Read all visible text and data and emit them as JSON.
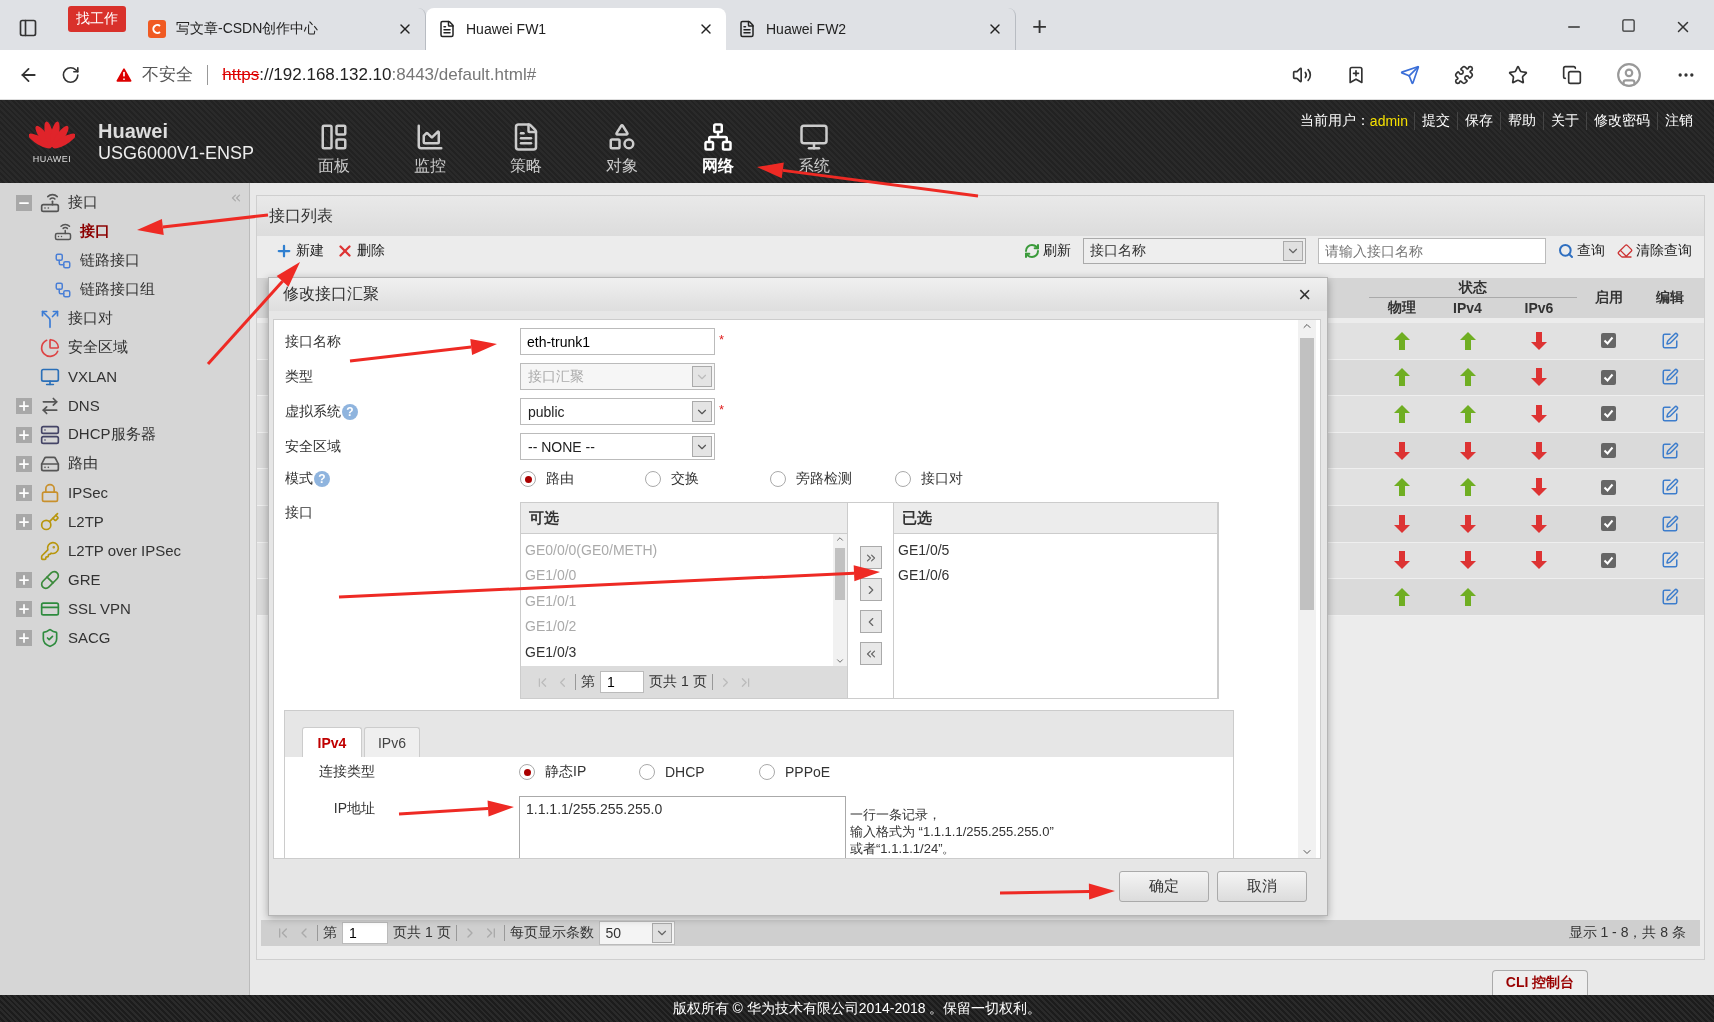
{
  "browser": {
    "badge": "找工作",
    "tabs": [
      {
        "label": "写文章-CSDN创作中心",
        "selected": false,
        "kind": "site"
      },
      {
        "label": "Huawei FW1",
        "selected": true,
        "kind": "page"
      },
      {
        "label": "Huawei FW2",
        "selected": false,
        "kind": "page"
      }
    ],
    "new_tab": "+",
    "security": "不安全",
    "url_scheme": "https",
    "url_host": "://192.168.132.10",
    "url_path": ":8443/default.html#"
  },
  "header": {
    "logo_text": "HUAWEI",
    "brand": "Huawei",
    "model": "USG6000V1-ENSP",
    "nav": [
      {
        "label": "面板",
        "selected": false
      },
      {
        "label": "监控",
        "selected": false
      },
      {
        "label": "策略",
        "selected": false
      },
      {
        "label": "对象",
        "selected": false
      },
      {
        "label": "网络",
        "selected": true
      },
      {
        "label": "系统",
        "selected": false
      }
    ],
    "user_label": "当前用户：",
    "user": "admin",
    "actions": [
      "提交",
      "保存",
      "帮助",
      "关于",
      "修改密码",
      "注销"
    ]
  },
  "sidebar": {
    "items": [
      {
        "label": "接口",
        "expanded": true,
        "selected": false,
        "children": [
          {
            "label": "接口",
            "selected": true
          },
          {
            "label": "链路接口",
            "selected": false
          },
          {
            "label": "链路接口组",
            "selected": false
          }
        ]
      },
      {
        "label": "接口对",
        "selected": false
      },
      {
        "label": "安全区域",
        "selected": false
      },
      {
        "label": "VXLAN",
        "selected": false
      },
      {
        "label": "DNS",
        "expanded": false,
        "selected": false
      },
      {
        "label": "DHCP服务器",
        "expanded": false,
        "selected": false
      },
      {
        "label": "路由",
        "expanded": false,
        "selected": false
      },
      {
        "label": "IPSec",
        "expanded": false,
        "selected": false
      },
      {
        "label": "L2TP",
        "expanded": false,
        "selected": false
      },
      {
        "label": "L2TP over IPSec",
        "selected": false
      },
      {
        "label": "GRE",
        "expanded": false,
        "selected": false
      },
      {
        "label": "SSL VPN",
        "expanded": false,
        "selected": false
      },
      {
        "label": "SACG",
        "expanded": false,
        "selected": false
      }
    ]
  },
  "panel": {
    "title": "接口列表",
    "toolbar": {
      "new": "新建",
      "delete": "删除",
      "refresh": "刷新",
      "filter": "接口名称",
      "search_placeholder": "请输入接口名称",
      "query": "查询",
      "clear": "清除查询"
    },
    "table": {
      "group_header": "状态",
      "columns": [
        "物理",
        "IPv4",
        "IPv6",
        "启用",
        "编辑"
      ],
      "rows": [
        {
          "physical_up": true,
          "ipv4_up": true,
          "ipv6_up": false,
          "enabled": true
        },
        {
          "physical_up": true,
          "ipv4_up": true,
          "ipv6_up": false,
          "enabled": true
        },
        {
          "physical_up": true,
          "ipv4_up": true,
          "ipv6_up": false,
          "enabled": true
        },
        {
          "physical_up": false,
          "ipv4_up": false,
          "ipv6_up": false,
          "enabled": true
        },
        {
          "physical_up": true,
          "ipv4_up": true,
          "ipv6_up": false,
          "enabled": true
        },
        {
          "physical_up": false,
          "ipv4_up": false,
          "ipv6_up": false,
          "enabled": true
        },
        {
          "physical_up": false,
          "ipv4_up": false,
          "ipv6_up": false,
          "enabled": true
        },
        {
          "physical_up": true,
          "ipv4_up": true
        }
      ]
    },
    "pager": {
      "page_label": "第",
      "page": "1",
      "total": "页共 1 页",
      "per_page_label": "每页显示条数",
      "per_page": "50",
      "summary": "显示 1 - 8，共 8 条"
    }
  },
  "dialog": {
    "title": "修改接口汇聚",
    "close": "×",
    "fields": [
      {
        "kind": "text",
        "label": "接口名称",
        "value": "eth-trunk1",
        "required_mark": "*"
      },
      {
        "kind": "select",
        "label": "类型",
        "value": "接口汇聚",
        "disabled": true
      },
      {
        "kind": "select",
        "label": "虚拟系统",
        "help": "?",
        "value": "public",
        "required_mark": "*"
      },
      {
        "kind": "select",
        "label": "安全区域",
        "value": "-- NONE --"
      },
      {
        "kind": "radio",
        "label": "模式",
        "help": "?",
        "options": [
          {
            "label": "路由",
            "selected": true
          },
          {
            "label": "交换",
            "selected": false
          },
          {
            "label": "旁路检测",
            "selected": false
          },
          {
            "label": "接口对",
            "selected": false
          }
        ]
      }
    ],
    "interfaces": {
      "label": "接口",
      "available_title": "可选",
      "available": [
        {
          "label": "GE0/0/0(GE0/METH)",
          "disabled": true
        },
        {
          "label": "GE1/0/0",
          "disabled": true
        },
        {
          "label": "GE1/0/1",
          "disabled": true
        },
        {
          "label": "GE1/0/2",
          "disabled": true
        },
        {
          "label": "GE1/0/3",
          "disabled": false
        }
      ],
      "pager": {
        "page_label": "第",
        "page": "1",
        "total": "页共 1 页"
      },
      "selected_title": "已选",
      "selected": [
        "GE1/0/5",
        "GE1/0/6"
      ]
    },
    "ip_tabs": [
      {
        "label": "IPv4",
        "selected": true
      },
      {
        "label": "IPv6",
        "selected": false
      }
    ],
    "connection_type": {
      "label": "连接类型",
      "options": [
        {
          "label": "静态IP",
          "selected": true
        },
        {
          "label": "DHCP",
          "selected": false
        },
        {
          "label": "PPPoE",
          "selected": false
        }
      ]
    },
    "ip_address": {
      "label": "IP地址",
      "value": "1.1.1.1/255.255.255.0",
      "hint": [
        "一行一条记录，",
        "输入格式为 “1.1.1.1/255.255.255.0”",
        "或者“1.1.1.1/24”。"
      ]
    },
    "buttons": [
      "确定",
      "取消"
    ]
  },
  "cli_button": "CLI 控制台",
  "footer": "版权所有 © 华为技术有限公司2014-2018 。保留一切权利。"
}
